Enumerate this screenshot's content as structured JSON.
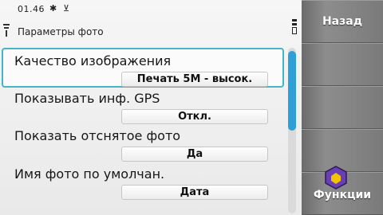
{
  "status": {
    "time": "01.46",
    "bluetooth_icon": "bluetooth-icon",
    "usb_icon": "usb-icon",
    "battery_icon": "battery-icon",
    "signal_icon": "signal-icon"
  },
  "title": "Параметры фото",
  "settings": [
    {
      "label": "Качество изображения",
      "value": "Печать 5M - высок.",
      "selected": true
    },
    {
      "label": "Показывать инф. GPS",
      "value": "Откл.",
      "selected": false
    },
    {
      "label": "Показать отснятое фото",
      "value": "Да",
      "selected": false
    },
    {
      "label": "Имя фото по умолчан.",
      "value": "Дата",
      "selected": false
    }
  ],
  "scroll": {
    "thumb_color": "#2f9fd8",
    "position_fraction": 0.0,
    "visible_fraction": 0.48
  },
  "softkeys": {
    "back": "Назад",
    "options": "Функции",
    "menu_icon": "menu-key-icon",
    "menu_icon_color": "#6a3fb5"
  },
  "colors": {
    "selection_border": "#43b6c6"
  }
}
